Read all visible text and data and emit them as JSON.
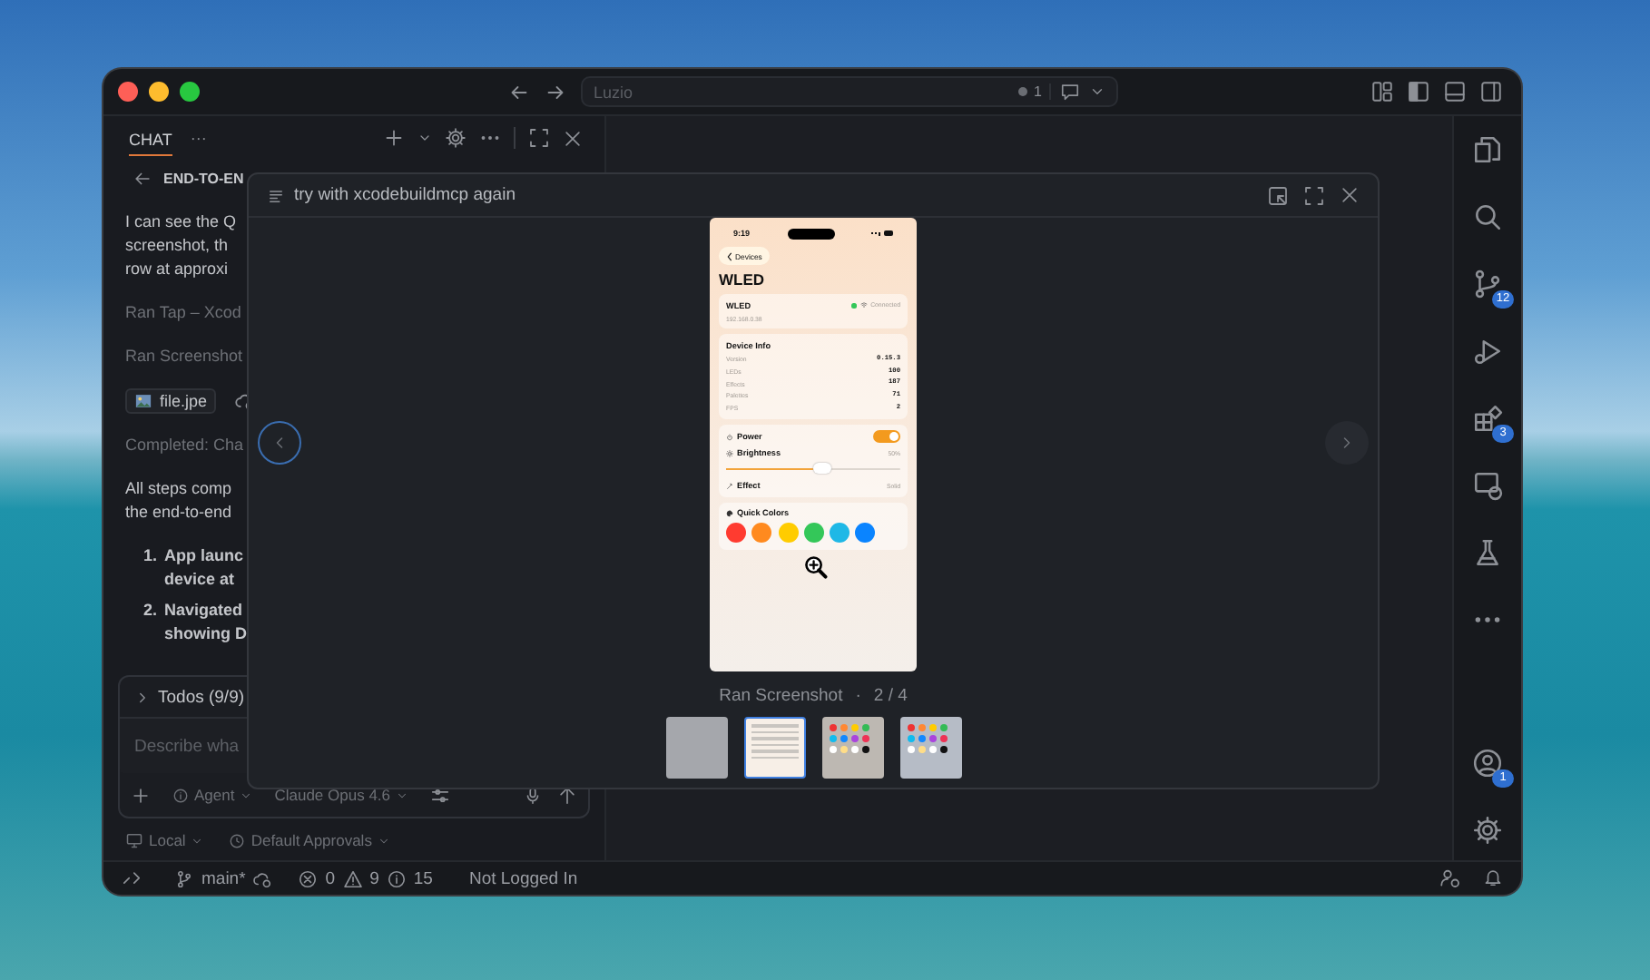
{
  "title_bar": {
    "search": {
      "placeholder": "Luzio"
    },
    "indicator": "1"
  },
  "chat": {
    "tab": "CHAT",
    "tab_more": "···",
    "session_title": "END-TO-EN",
    "messages": [
      {
        "kind": "text",
        "lines": [
          "I can see the Q",
          "screenshot, th",
          "row at approxi"
        ]
      },
      {
        "kind": "tool",
        "text": "Ran Tap – Xcod"
      },
      {
        "kind": "tool",
        "text": "Ran Screenshot"
      },
      {
        "kind": "file",
        "name": "file.jpe"
      },
      {
        "kind": "tool",
        "text": "Completed: Cha"
      },
      {
        "kind": "text",
        "lines": [
          "All steps comp",
          "the end-to-end"
        ]
      },
      {
        "kind": "list",
        "items": [
          {
            "number": "1.",
            "lines": [
              "App launc",
              "device at"
            ]
          },
          {
            "number": "2.",
            "lines": [
              "Navigated",
              "showing D"
            ]
          }
        ]
      }
    ],
    "todos": "Todos (9/9)",
    "input": {
      "placeholder": "Describe wha"
    },
    "mode": "Agent",
    "model": "Claude Opus 4.6",
    "location": "Local",
    "approvals": "Default Approvals"
  },
  "viewer": {
    "title": "try with xcodebuildmcp again",
    "caption": "Ran Screenshot",
    "separator": "·",
    "counter": "2 / 4",
    "phone": {
      "time": "9:19",
      "back": "Devices",
      "title": "WLED",
      "device": {
        "name": "WLED",
        "address": "192.168.0.38",
        "status": "Connected"
      },
      "info_title": "Device Info",
      "info_rows": [
        {
          "label": "Version",
          "value": "0.15.3"
        },
        {
          "label": "LEDs",
          "value": "100"
        },
        {
          "label": "Effects",
          "value": "187"
        },
        {
          "label": "Palettes",
          "value": "71"
        },
        {
          "label": "FPS",
          "value": "2"
        }
      ],
      "power": {
        "label": "Power",
        "on": true
      },
      "brightness": {
        "label": "Brightness",
        "reading": "50%",
        "level": 0.5
      },
      "effect": {
        "label": "Effect",
        "value": "Solid"
      },
      "quick_colors": {
        "label": "Quick Colors",
        "colors": [
          {
            "color": "#ff3b30"
          },
          {
            "color": "#ff8a1f"
          },
          {
            "color": "#ffcc00"
          },
          {
            "color": "#34c759"
          },
          {
            "color": "#1fb8e6"
          },
          {
            "color": "#0a84ff"
          }
        ]
      }
    },
    "thumbnails": [
      {
        "kind": "blank",
        "selected": false
      },
      {
        "kind": "device-info",
        "selected": true
      },
      {
        "kind": "colors",
        "selected": false
      },
      {
        "kind": "colors-blue",
        "selected": false
      }
    ]
  },
  "activity_bar": {
    "items": [
      {
        "kind": "files"
      },
      {
        "kind": "search"
      },
      {
        "kind": "source-control",
        "badge": "12"
      },
      {
        "kind": "run-debug"
      },
      {
        "kind": "extensions",
        "badge": "3"
      },
      {
        "kind": "remote"
      },
      {
        "kind": "testing"
      },
      {
        "kind": "more"
      }
    ],
    "bottom": [
      {
        "kind": "account",
        "badge": "1"
      },
      {
        "kind": "settings"
      }
    ]
  },
  "status_bar": {
    "branch": "main*",
    "errors": "0",
    "warnings": "9",
    "infos": "15",
    "login": "Not Logged In"
  }
}
